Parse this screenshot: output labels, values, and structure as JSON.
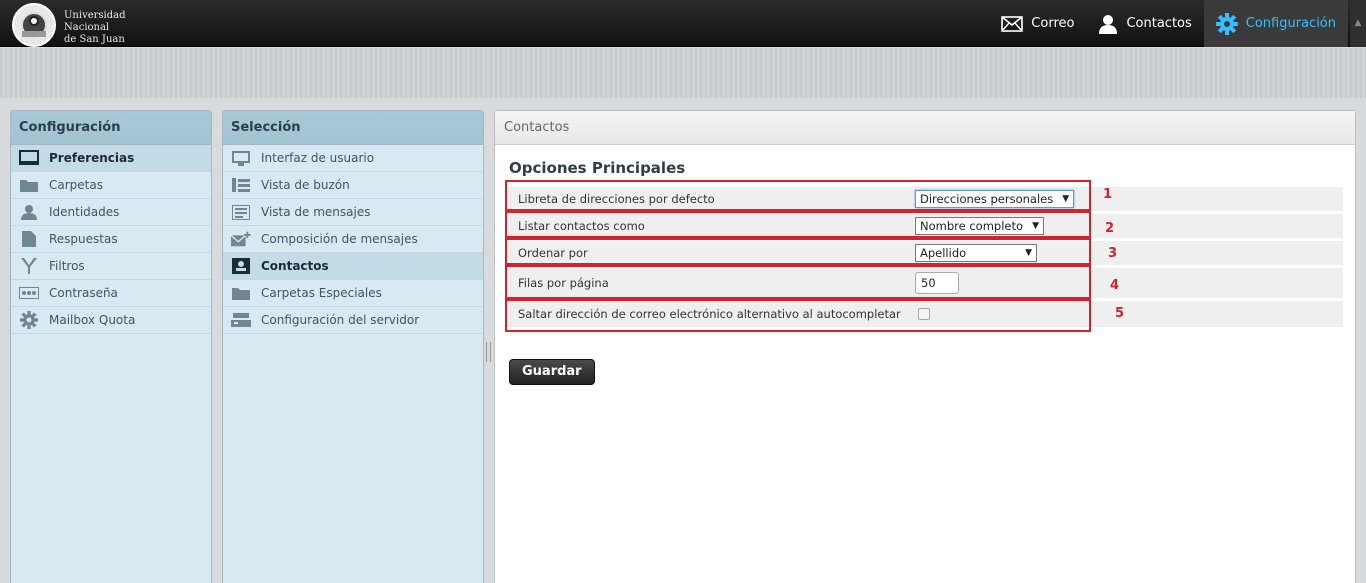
{
  "branding": {
    "line1": "Universidad",
    "line2": "Nacional",
    "line3": "de San Juan"
  },
  "topnav": {
    "mail": "Correo",
    "contacts": "Contactos",
    "settings": "Configuración"
  },
  "sidebar": {
    "title": "Configuración",
    "items": [
      {
        "label": "Preferencias",
        "icon": "monitor-icon"
      },
      {
        "label": "Carpetas",
        "icon": "folder-icon"
      },
      {
        "label": "Identidades",
        "icon": "user-icon"
      },
      {
        "label": "Respuestas",
        "icon": "document-icon"
      },
      {
        "label": "Filtros",
        "icon": "filter-icon"
      },
      {
        "label": "Contraseña",
        "icon": "password-icon"
      },
      {
        "label": "Mailbox Quota",
        "icon": "gear-icon"
      }
    ]
  },
  "section_list": {
    "title": "Selección",
    "items": [
      {
        "label": "Interfaz de usuario",
        "icon": "monitor-icon"
      },
      {
        "label": "Vista de buzón",
        "icon": "list-icon"
      },
      {
        "label": "Vista de mensajes",
        "icon": "message-icon"
      },
      {
        "label": "Composición de mensajes",
        "icon": "compose-icon"
      },
      {
        "label": "Contactos",
        "icon": "contact-card-icon"
      },
      {
        "label": "Carpetas Especiales",
        "icon": "folder-icon"
      },
      {
        "label": "Configuración del servidor",
        "icon": "server-icon"
      }
    ]
  },
  "main": {
    "header": "Contactos",
    "section_title": "Opciones Principales",
    "rows": [
      {
        "label": "Libreta de direcciones por defecto",
        "value": "Direcciones personales",
        "num": "1"
      },
      {
        "label": "Listar contactos como",
        "value": "Nombre completo",
        "num": "2"
      },
      {
        "label": "Ordenar por",
        "value": "Apellido",
        "num": "3"
      },
      {
        "label": "Filas por página",
        "value": "50",
        "num": "4"
      },
      {
        "label": "Saltar dirección de correo electrónico alternativo al autocompletar",
        "value": "",
        "num": "5"
      }
    ],
    "save_label": "Guardar"
  },
  "colors": {
    "accent": "#37beff",
    "annotation": "#d3212d",
    "panel": "#d8e9f1"
  }
}
